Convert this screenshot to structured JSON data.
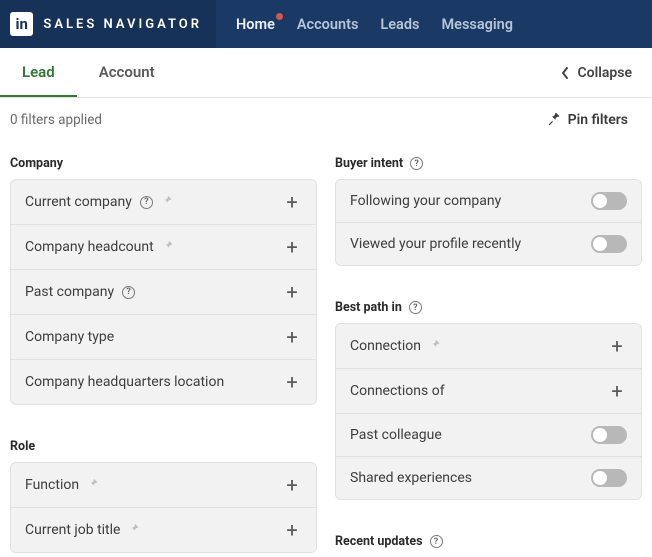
{
  "brand": {
    "logo_text": "in",
    "name": "SALES NAVIGATOR"
  },
  "nav": {
    "home": "Home",
    "accounts": "Accounts",
    "leads": "Leads",
    "messaging": "Messaging"
  },
  "tabs": {
    "lead": "Lead",
    "account": "Account"
  },
  "collapse_label": "Collapse",
  "filters_applied": "0 filters applied",
  "pin_filters_label": "Pin filters",
  "sections": {
    "company": "Company",
    "role": "Role",
    "buyer_intent": "Buyer intent",
    "best_path_in": "Best path in",
    "recent_updates": "Recent updates"
  },
  "company_filters": {
    "current_company": "Current company",
    "headcount": "Company headcount",
    "past_company": "Past company",
    "company_type": "Company type",
    "hq_location": "Company headquarters location"
  },
  "role_filters": {
    "function": "Function",
    "current_job_title": "Current job title"
  },
  "buyer_intent_filters": {
    "following": "Following your company",
    "viewed_profile": "Viewed your profile recently"
  },
  "best_path_filters": {
    "connection": "Connection",
    "connections_of": "Connections of",
    "past_colleague": "Past colleague",
    "shared_experiences": "Shared experiences"
  }
}
